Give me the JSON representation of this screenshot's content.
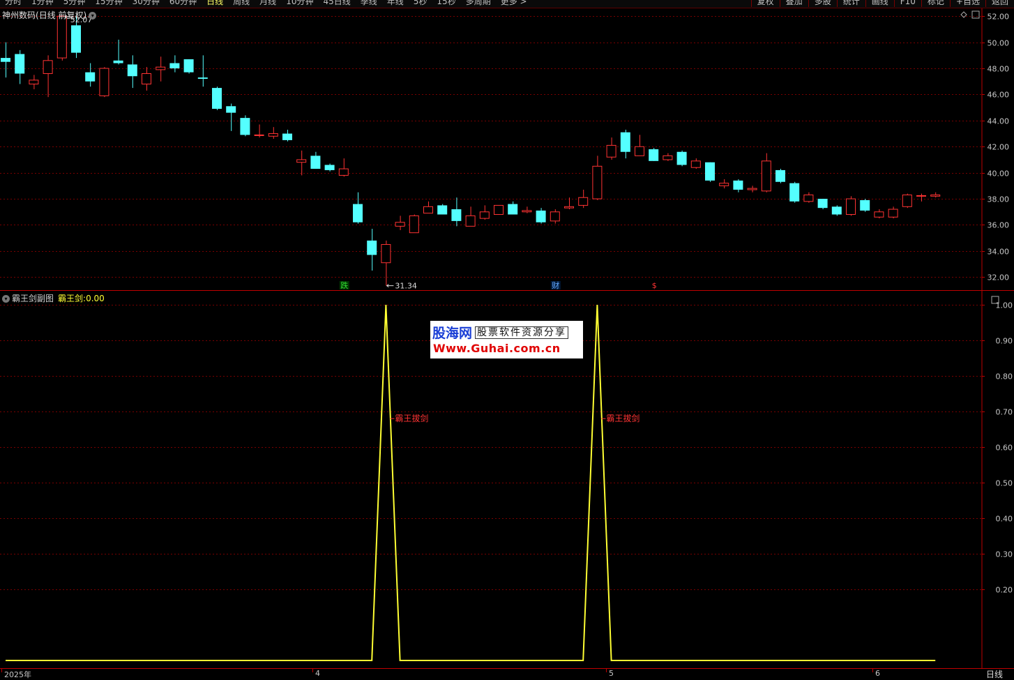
{
  "toolbar": {
    "periods": [
      "分时",
      "1分钟",
      "5分钟",
      "15分钟",
      "30分钟",
      "60分钟",
      "日线",
      "周线",
      "月线",
      "10分钟",
      "45日线",
      "季线",
      "年线",
      "5秒",
      "15秒",
      "多周期",
      "更多 >"
    ],
    "active_period": "日线",
    "right_buttons": [
      "复权",
      "叠加",
      "多股",
      "统计",
      "画线",
      "F10",
      "标记",
      "+自选",
      "返回"
    ]
  },
  "price_panel": {
    "stock_name": "神州数码",
    "mode": "(日线 前复权)",
    "high_marker": "52.07",
    "low_marker": "31.34",
    "event_badges": [
      {
        "text": "跌",
        "color": "#33dd33",
        "bg": "#003300",
        "index": 24
      },
      {
        "text": "财",
        "color": "#66aaff",
        "bg": "#001a3a",
        "index": 39
      },
      {
        "text": "$",
        "color": "#ff3333",
        "bg": "",
        "index": 46
      }
    ]
  },
  "indicator_panel": {
    "name": "霸王剑副图",
    "series_name": "霸王剑:",
    "series_value": "0.00",
    "signal_label": "霸王拔剑",
    "line_color": "#ffff33"
  },
  "date_axis": {
    "labels": [
      "2025年",
      "4",
      "5",
      "6"
    ]
  },
  "bottom_tab": "日线",
  "watermark": {
    "brand": "股海网",
    "slogan": "股票软件资源分享",
    "url": "Www.Guhai.com.cn"
  },
  "colors": {
    "up": "#ff3333",
    "down": "#54ffff",
    "grid": "#7a0000",
    "axis": "#c00000",
    "axis_text": "#c8c8c8"
  },
  "chart_data": [
    {
      "type": "candlestick",
      "title": "",
      "ylim": [
        31.0,
        52.6
      ],
      "y_ticks": [
        32,
        34,
        36,
        38,
        40,
        42,
        44,
        46,
        48,
        50,
        52
      ],
      "y_tick_labels": [
        "32.00",
        "34.00",
        "36.00",
        "38.00",
        "40.00",
        "42.00",
        "44.00",
        "46.00",
        "48.00",
        "50.00",
        "52.00"
      ],
      "ohlc": [
        [
          48.8,
          50.0,
          47.3,
          48.5
        ],
        [
          49.1,
          49.4,
          46.8,
          47.6
        ],
        [
          46.8,
          47.5,
          46.4,
          47.1
        ],
        [
          47.6,
          49.0,
          45.8,
          48.6
        ],
        [
          48.8,
          52.07,
          48.6,
          52.0
        ],
        [
          51.3,
          52.0,
          48.8,
          49.2
        ],
        [
          47.7,
          48.4,
          46.6,
          47.0
        ],
        [
          45.9,
          48.1,
          45.8,
          48.0
        ],
        [
          48.6,
          50.2,
          48.3,
          48.4
        ],
        [
          48.3,
          49.0,
          46.5,
          47.4
        ],
        [
          46.8,
          48.1,
          46.3,
          47.6
        ],
        [
          47.9,
          48.9,
          47.0,
          48.1
        ],
        [
          48.4,
          49.0,
          47.7,
          48.0
        ],
        [
          48.7,
          48.7,
          47.6,
          47.7
        ],
        [
          47.3,
          49.0,
          46.6,
          47.2
        ],
        [
          46.5,
          46.6,
          44.8,
          44.9
        ],
        [
          45.1,
          45.3,
          43.2,
          44.6
        ],
        [
          44.2,
          44.4,
          42.8,
          42.9
        ],
        [
          42.9,
          43.7,
          42.7,
          42.9
        ],
        [
          42.8,
          43.5,
          42.6,
          43.0
        ],
        [
          43.0,
          43.3,
          42.4,
          42.5
        ],
        [
          40.8,
          41.7,
          39.8,
          41.0
        ],
        [
          41.3,
          41.6,
          40.3,
          40.3
        ],
        [
          40.6,
          40.7,
          40.1,
          40.2
        ],
        [
          39.8,
          41.1,
          39.7,
          40.3
        ],
        [
          37.6,
          38.5,
          36.1,
          36.2
        ],
        [
          34.8,
          35.7,
          32.5,
          33.7
        ],
        [
          33.1,
          34.8,
          31.34,
          34.5
        ],
        [
          35.9,
          36.7,
          35.6,
          36.2
        ],
        [
          35.4,
          36.8,
          35.4,
          36.7
        ],
        [
          36.9,
          37.8,
          36.9,
          37.4
        ],
        [
          37.5,
          37.6,
          36.8,
          36.8
        ],
        [
          37.2,
          38.1,
          35.9,
          36.3
        ],
        [
          35.9,
          37.4,
          35.9,
          36.7
        ],
        [
          36.5,
          37.5,
          36.4,
          37.0
        ],
        [
          36.8,
          37.5,
          36.8,
          37.5
        ],
        [
          37.6,
          37.8,
          36.8,
          36.8
        ],
        [
          37.0,
          37.4,
          36.9,
          37.1
        ],
        [
          37.1,
          37.3,
          36.1,
          36.2
        ],
        [
          36.3,
          37.2,
          36.1,
          37.0
        ],
        [
          37.3,
          38.1,
          37.2,
          37.4
        ],
        [
          37.5,
          38.7,
          37.3,
          38.1
        ],
        [
          38.0,
          41.3,
          37.9,
          40.5
        ],
        [
          41.2,
          42.7,
          41.0,
          42.1
        ],
        [
          43.1,
          43.3,
          41.1,
          41.6
        ],
        [
          41.3,
          42.9,
          41.3,
          42.0
        ],
        [
          41.8,
          41.9,
          40.9,
          40.9
        ],
        [
          41.0,
          41.5,
          40.9,
          41.3
        ],
        [
          41.6,
          41.7,
          40.5,
          40.6
        ],
        [
          40.4,
          41.1,
          40.3,
          40.9
        ],
        [
          40.8,
          40.8,
          39.3,
          39.4
        ],
        [
          39.0,
          39.5,
          38.8,
          39.2
        ],
        [
          39.4,
          39.5,
          38.5,
          38.7
        ],
        [
          38.7,
          39.0,
          38.5,
          38.8
        ],
        [
          38.6,
          41.5,
          38.5,
          40.9
        ],
        [
          40.2,
          40.3,
          39.2,
          39.3
        ],
        [
          39.2,
          39.3,
          37.7,
          37.8
        ],
        [
          37.8,
          38.5,
          37.7,
          38.3
        ],
        [
          38.0,
          38.0,
          37.2,
          37.3
        ],
        [
          37.4,
          37.5,
          36.7,
          36.8
        ],
        [
          36.8,
          38.2,
          36.7,
          38.0
        ],
        [
          37.9,
          38.0,
          37.0,
          37.1
        ],
        [
          36.6,
          37.2,
          36.5,
          37.0
        ],
        [
          36.6,
          37.4,
          36.5,
          37.2
        ],
        [
          37.4,
          38.4,
          37.3,
          38.3
        ],
        [
          38.2,
          38.4,
          37.8,
          38.25
        ],
        [
          38.2,
          38.5,
          38.1,
          38.3
        ]
      ]
    },
    {
      "type": "line",
      "title": "",
      "ylim": [
        0.0,
        1.02
      ],
      "y_ticks": [
        0.2,
        0.3,
        0.4,
        0.5,
        0.6,
        0.7,
        0.8,
        0.9,
        1.0
      ],
      "y_tick_labels": [
        "0.20",
        "0.30",
        "0.40",
        "0.50",
        "0.60",
        "0.70",
        "0.80",
        "0.90",
        "1.00"
      ],
      "series": [
        {
          "name": "霸王剑",
          "values": [
            0,
            0,
            0,
            0,
            0,
            0,
            0,
            0,
            0,
            0,
            0,
            0,
            0,
            0,
            0,
            0,
            0,
            0,
            0,
            0,
            0,
            0,
            0,
            0,
            0,
            0,
            0,
            1,
            0,
            0,
            0,
            0,
            0,
            0,
            0,
            0,
            0,
            0,
            0,
            0,
            0,
            0,
            1,
            0,
            0,
            0,
            0,
            0,
            0,
            0,
            0,
            0,
            0,
            0,
            0,
            0,
            0,
            0,
            0,
            0,
            0,
            0,
            0,
            0,
            0,
            0,
            0
          ]
        }
      ],
      "annotations": [
        {
          "text": "霸王拔剑",
          "index": 27,
          "y": 0.68
        },
        {
          "text": "霸王拔剑",
          "index": 42,
          "y": 0.68
        }
      ]
    }
  ]
}
